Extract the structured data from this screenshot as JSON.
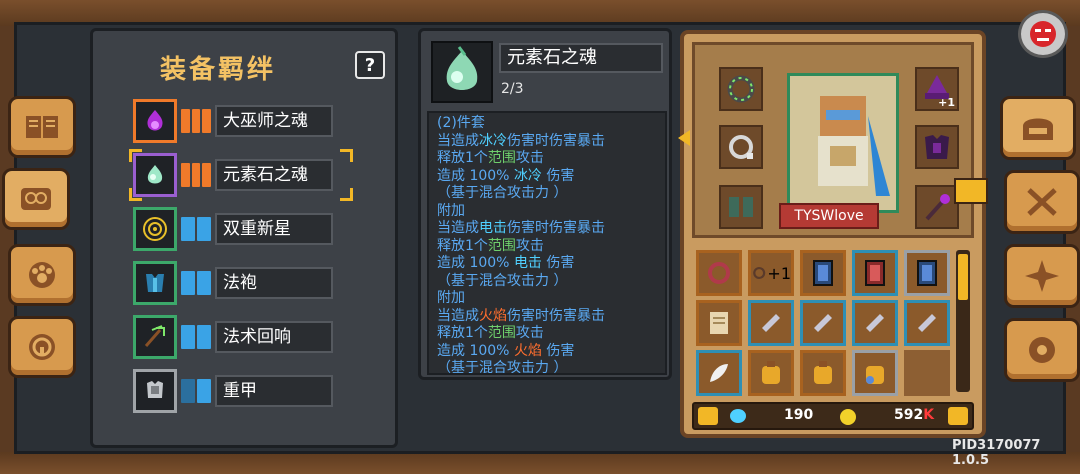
{
  "bonds_panel": {
    "title": "装备羁绊",
    "help_label": "?",
    "items": [
      {
        "label": "大巫师之魂",
        "tier": "orange",
        "icon": "purple-soul-icon",
        "selected": false
      },
      {
        "label": "元素石之魂",
        "tier": "orange",
        "icon": "element-soul-icon",
        "selected": true
      },
      {
        "label": "双重新星",
        "tier": "blue",
        "icon": "double-nova-icon",
        "selected": false
      },
      {
        "label": "法袍",
        "tier": "blue",
        "icon": "robe-icon",
        "selected": false
      },
      {
        "label": "法术回响",
        "tier": "blue",
        "icon": "spell-echo-icon",
        "selected": false
      },
      {
        "label": "重甲",
        "tier": "blue-partial",
        "icon": "heavy-armor-icon",
        "selected": false
      }
    ]
  },
  "detail": {
    "name": "元素石之魂",
    "count": "2/3",
    "lines": [
      [
        {
          "t": "(2)件套",
          "c": ""
        }
      ],
      [
        {
          "t": "当造成",
          "c": ""
        },
        {
          "t": "冰冷",
          "c": "ice"
        },
        {
          "t": "伤害时伤害暴击",
          "c": ""
        }
      ],
      [
        {
          "t": "释放1个",
          "c": ""
        },
        {
          "t": "范围",
          "c": "zone"
        },
        {
          "t": "攻击",
          "c": ""
        }
      ],
      [
        {
          "t": "造成 100% ",
          "c": ""
        },
        {
          "t": "冰冷",
          "c": "ice"
        },
        {
          "t": " 伤害",
          "c": ""
        }
      ],
      [
        {
          "t": "（基于混合攻击力 ）",
          "c": ""
        }
      ],
      [
        {
          "t": "附加",
          "c": ""
        }
      ],
      [
        {
          "t": "当造成",
          "c": ""
        },
        {
          "t": "电击",
          "c": "ice"
        },
        {
          "t": "伤害时伤害暴击",
          "c": ""
        }
      ],
      [
        {
          "t": "释放1个",
          "c": ""
        },
        {
          "t": "范围",
          "c": "zone"
        },
        {
          "t": "攻击",
          "c": ""
        }
      ],
      [
        {
          "t": "造成 100% ",
          "c": ""
        },
        {
          "t": "电击",
          "c": "ice"
        },
        {
          "t": " 伤害",
          "c": ""
        }
      ],
      [
        {
          "t": "（基于混合攻击力 ）",
          "c": ""
        }
      ],
      [
        {
          "t": "附加",
          "c": ""
        }
      ],
      [
        {
          "t": "当造成",
          "c": ""
        },
        {
          "t": "火焰",
          "c": "fire"
        },
        {
          "t": "伤害时伤害暴击",
          "c": ""
        }
      ],
      [
        {
          "t": "释放1个",
          "c": ""
        },
        {
          "t": "范围",
          "c": "zone"
        },
        {
          "t": "攻击",
          "c": ""
        }
      ],
      [
        {
          "t": "造成 100% ",
          "c": ""
        },
        {
          "t": "火焰",
          "c": "fire"
        },
        {
          "t": " 伤害",
          "c": ""
        }
      ],
      [
        {
          "t": "（基于混合攻击力 ）",
          "c": ""
        }
      ]
    ]
  },
  "character": {
    "name": "TYSWlove"
  },
  "equipment_plus_labels": [
    "+1",
    "+1"
  ],
  "currency": {
    "gems": "190",
    "gold": "592",
    "gold_suffix": "K"
  },
  "footer": {
    "pid": "PID3170077 1.0.5"
  },
  "colors": {
    "tier_orange": "#f07a2a",
    "tier_blue": "#3aa3e6",
    "accent_gold": "#f2b726",
    "title_gold": "#f4c264"
  }
}
